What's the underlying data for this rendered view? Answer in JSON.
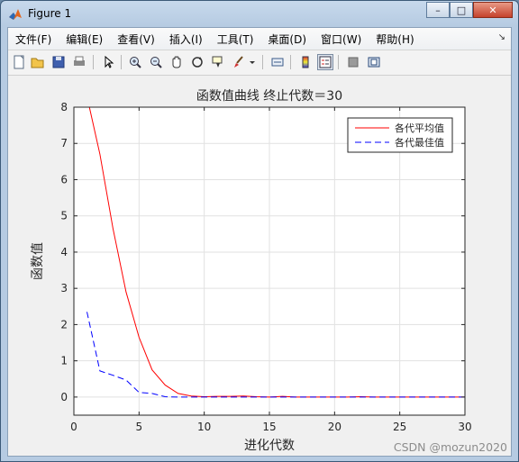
{
  "window": {
    "title": "Figure 1"
  },
  "title_buttons": {
    "minimize": "–",
    "maximize": "□",
    "close": "✕"
  },
  "menu": {
    "items": [
      {
        "label": "文件(F)"
      },
      {
        "label": "编辑(E)"
      },
      {
        "label": "查看(V)"
      },
      {
        "label": "插入(I)"
      },
      {
        "label": "工具(T)"
      },
      {
        "label": "桌面(D)"
      },
      {
        "label": "窗口(W)"
      },
      {
        "label": "帮助(H)"
      }
    ],
    "overflow": "↘"
  },
  "toolbar": {
    "icons": [
      "new-figure-icon",
      "open-file-icon",
      "save-icon",
      "print-icon",
      "pointer-icon",
      "zoom-in-icon",
      "zoom-out-icon",
      "pan-icon",
      "rotate-3d-icon",
      "data-cursor-icon",
      "brush-icon",
      "brush-dropdown-icon",
      "link-plot-icon",
      "insert-colorbar-icon",
      "insert-legend-icon",
      "hide-plot-tools-icon",
      "show-plot-tools-icon"
    ]
  },
  "chart_data": {
    "type": "line",
    "title": "函数值曲线  终止代数＝30",
    "xlabel": "进化代数",
    "ylabel": "函数值",
    "xlim": [
      0,
      30
    ],
    "ylim": [
      -0.5,
      8
    ],
    "xticks": [
      "0",
      "5",
      "10",
      "15",
      "20",
      "25",
      "30"
    ],
    "yticks": [
      "0",
      "1",
      "2",
      "3",
      "4",
      "5",
      "6",
      "7",
      "8"
    ],
    "grid": true,
    "legend_position": "top-right",
    "series": [
      {
        "name": "各代平均值",
        "color": "#ff0000",
        "style": "solid",
        "x": [
          1,
          2,
          3,
          4,
          5,
          6,
          7,
          8,
          9,
          10,
          11,
          12,
          13,
          14,
          15,
          16,
          17,
          18,
          19,
          20,
          21,
          22,
          23,
          24,
          25,
          26,
          27,
          28,
          29,
          30
        ],
        "values": [
          8.3,
          6.7,
          4.65,
          2.9,
          1.65,
          0.75,
          0.33,
          0.1,
          0.03,
          0.01,
          0.02,
          0.02,
          0.03,
          0.01,
          0.0,
          0.02,
          0.0,
          0.0,
          0.0,
          0.0,
          0.0,
          0.01,
          0.0,
          0.0,
          0.0,
          0.0,
          0.0,
          0.0,
          0.0,
          0.0
        ]
      },
      {
        "name": "各代最佳值",
        "color": "#0000ff",
        "style": "dashed",
        "x": [
          1,
          2,
          3,
          4,
          5,
          6,
          7,
          8,
          9,
          10,
          11,
          12,
          13,
          14,
          15,
          16,
          17,
          18,
          19,
          20,
          21,
          22,
          23,
          24,
          25,
          26,
          27,
          28,
          29,
          30
        ],
        "values": [
          2.35,
          0.72,
          0.6,
          0.47,
          0.13,
          0.1,
          0.01,
          0.0,
          0.0,
          0.0,
          0.0,
          0.0,
          0.0,
          0.0,
          0.0,
          0.0,
          0.0,
          0.0,
          0.0,
          0.0,
          0.0,
          0.0,
          0.0,
          0.0,
          0.0,
          0.0,
          0.0,
          0.0,
          0.0,
          0.0
        ]
      }
    ]
  },
  "watermark": "CSDN @mozun2020"
}
